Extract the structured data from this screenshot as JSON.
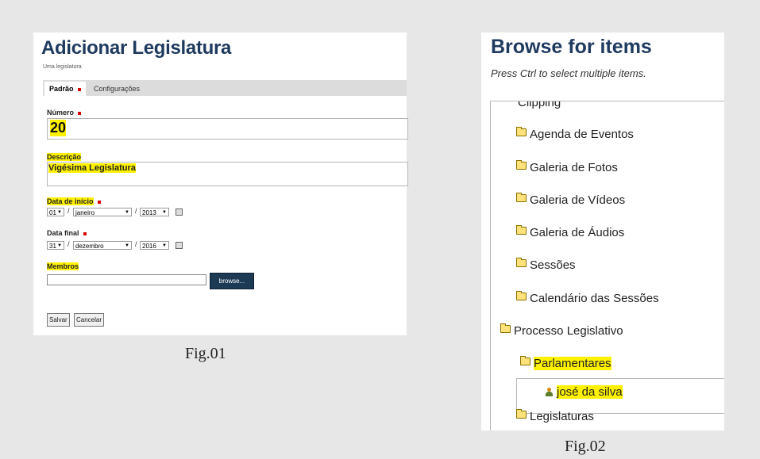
{
  "fig1": {
    "title": "Adicionar Legislatura",
    "subtitle": "Uma legislatura",
    "tabs": [
      {
        "label": "Padrão",
        "active": true,
        "required": true
      },
      {
        "label": "Configurações",
        "active": false
      }
    ],
    "numero": {
      "label": "Número",
      "value": "20"
    },
    "descricao": {
      "label": "Descrição",
      "value": "Vigésima Legislatura"
    },
    "data_inicio": {
      "label": "Data de início",
      "day": "01",
      "month": "janeiro",
      "year": "2013"
    },
    "data_final": {
      "label": "Data final",
      "day": "31",
      "month": "dezembro",
      "year": "2016"
    },
    "membros": {
      "label": "Membros",
      "value": "",
      "browse_label": "browse..."
    },
    "buttons": {
      "save": "Salvar",
      "cancel": "Cancelar"
    },
    "caption": "Fig.01"
  },
  "fig2": {
    "title": "Browse for items",
    "subtitle": "Press Ctrl to select multiple items.",
    "tree": {
      "items": [
        {
          "label": "Clipping"
        },
        {
          "label": "Agenda de Eventos"
        },
        {
          "label": "Galeria de Fotos"
        },
        {
          "label": "Galeria de Vídeos"
        },
        {
          "label": "Galeria de Áudios"
        },
        {
          "label": "Sessões"
        },
        {
          "label": "Calendário das Sessões"
        },
        {
          "label": "Processo Legislativo"
        },
        {
          "label": "Parlamentares",
          "selected": true
        },
        {
          "label": "josé da silva",
          "type": "person"
        },
        {
          "label": "Legislaturas"
        }
      ]
    },
    "caption": "Fig.02"
  },
  "colors": {
    "title": "#1e3a5f",
    "highlight": "#fff200",
    "required_marker": "#d40000",
    "browse_button": "#1d3a55",
    "folder": "#ffe37a",
    "background": "#e7e7e8"
  },
  "icons": [
    "required-marker",
    "dropdown-arrow-icon",
    "calendar-icon",
    "folder-icon",
    "person-icon"
  ]
}
